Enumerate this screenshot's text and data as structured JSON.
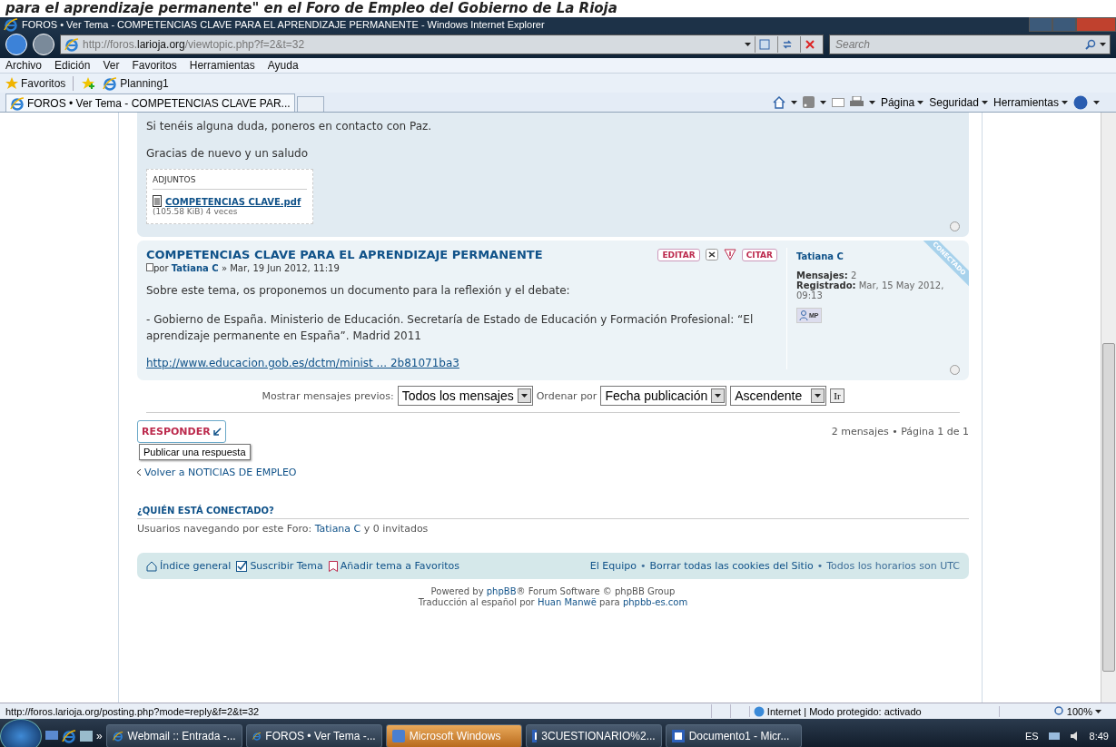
{
  "caption": "para el aprendizaje permanente\" en el Foro de Empleo del Gobierno de La Rioja",
  "window": {
    "title": "FOROS • Ver Tema - COMPETENCIAS CLAVE PARA EL APRENDIZAJE PERMANENTE - Windows Internet Explorer"
  },
  "address": {
    "url_host": "http://foros.",
    "url_domain": "larioja.org",
    "url_path": "/viewtopic.php?f=2&t=32",
    "search_placeholder": "Search"
  },
  "menu": [
    "Archivo",
    "Edición",
    "Ver",
    "Favoritos",
    "Herramientas",
    "Ayuda"
  ],
  "favorites_bar": {
    "label": "Favoritos",
    "items": [
      "Planning1"
    ]
  },
  "tabs": [
    {
      "label": "FOROS • Ver Tema - COMPETENCIAS CLAVE PAR...",
      "selected": true
    }
  ],
  "command_bar": [
    "Página",
    "Seguridad",
    "Herramientas"
  ],
  "post_tail": {
    "lines": [
      "Si tenéis alguna duda, poneros en contacto con Paz.",
      "Gracias de nuevo y un saludo"
    ],
    "attachments": {
      "title": "ADJUNTOS",
      "file": "COMPETENCIAS CLAVE.pdf",
      "meta": "(105.58 KiB) 4 veces"
    }
  },
  "post": {
    "title": "COMPETENCIAS CLAVE PARA EL APRENDIZAJE PERMANENTE",
    "by": "por",
    "author": "Tatiana C",
    "date": "» Mar, 19 Jun 2012, 11:19",
    "body": [
      "Sobre este tema, os proponemos un documento para la reflexión y el debate:",
      "- Gobierno de España. Ministerio de Educación. Secretaría de Estado de Educación y Formación Profesional: “El aprendizaje permanente en España”. Madrid 2011"
    ],
    "link": "http://www.educacion.gob.es/dctm/minist ... 2b81071ba3",
    "actions": [
      {
        "kind": "edit",
        "label": "EDITAR"
      },
      {
        "kind": "delete"
      },
      {
        "kind": "report"
      },
      {
        "kind": "quote",
        "label": "CITAR"
      }
    ],
    "profile": {
      "name": "Tatiana C",
      "stats": [
        {
          "label": "Mensajes:",
          "value": "2"
        },
        {
          "label": "Registrado:",
          "value": "Mar, 15 May 2012, 09:13"
        }
      ],
      "badge": "CONECTADO",
      "pm": "MP"
    }
  },
  "sort_bar": {
    "label_1": "Mostrar mensajes previos:",
    "select_1": "Todos los mensajes",
    "label_2": "Ordenar por",
    "select_2": "Fecha publicación",
    "select_3": "Ascendente",
    "go": "Ir"
  },
  "reply_button": "RESPONDER",
  "pagination": "2 mensajes • Página 1 de 1",
  "tooltip": "Publicar una respuesta",
  "back_link": "Volver a NOTICIAS DE EMPLEO",
  "who_online": {
    "title": "¿QUIÉN ESTÁ CONECTADO?",
    "parts": [
      {
        "text": "Usuarios navegando por este Foro: ",
        "link": false
      },
      {
        "text": "Tatiana C",
        "link": true
      },
      {
        "text": " y 0 invitados",
        "link": false
      }
    ]
  },
  "footer_nav": {
    "left": [
      {
        "kind": "home",
        "label": "Índice general"
      },
      {
        "kind": "subscribe",
        "label": "Suscribir Tema"
      },
      {
        "kind": "bookmark",
        "label": "Añadir tema a Favoritos"
      }
    ],
    "right": [
      {
        "text": "El Equipo",
        "link": true
      },
      {
        "text": "•",
        "link": false
      },
      {
        "text": "Borrar todas las cookies del Sitio",
        "link": true
      },
      {
        "text": "•",
        "link": false
      },
      {
        "text": "Todos los horarios son UTC",
        "link": false
      }
    ]
  },
  "credits": [
    [
      {
        "text": "Powered by ",
        "link": false
      },
      {
        "text": "phpBB",
        "link": true
      },
      {
        "text": "® Forum Software © phpBB Group",
        "link": false
      }
    ],
    [
      {
        "text": "Traducción al español por ",
        "link": false
      },
      {
        "text": "Huan Manwë",
        "link": true
      },
      {
        "text": " para ",
        "link": false
      },
      {
        "text": "phpbb-es.com",
        "link": true
      }
    ]
  ],
  "status_bar": {
    "url": "http://foros.larioja.org/posting.php?mode=reply&f=2&t=32",
    "zone": "Internet | Modo protegido: activado",
    "zoom": "100%"
  },
  "taskbar": {
    "more": "»",
    "tasks": [
      {
        "label": "Webmail :: Entrada -...",
        "kind": "ie",
        "selected": false
      },
      {
        "label": "FOROS • Ver Tema -...",
        "kind": "ie",
        "selected": false
      },
      {
        "label": "Microsoft Windows",
        "kind": "app",
        "selected": true
      },
      {
        "label": "3CUESTIONARIO%2...",
        "kind": "word",
        "selected": false
      },
      {
        "label": "Documento1 - Micr...",
        "kind": "word",
        "selected": false
      }
    ],
    "lang": "ES",
    "time": "8:49"
  }
}
